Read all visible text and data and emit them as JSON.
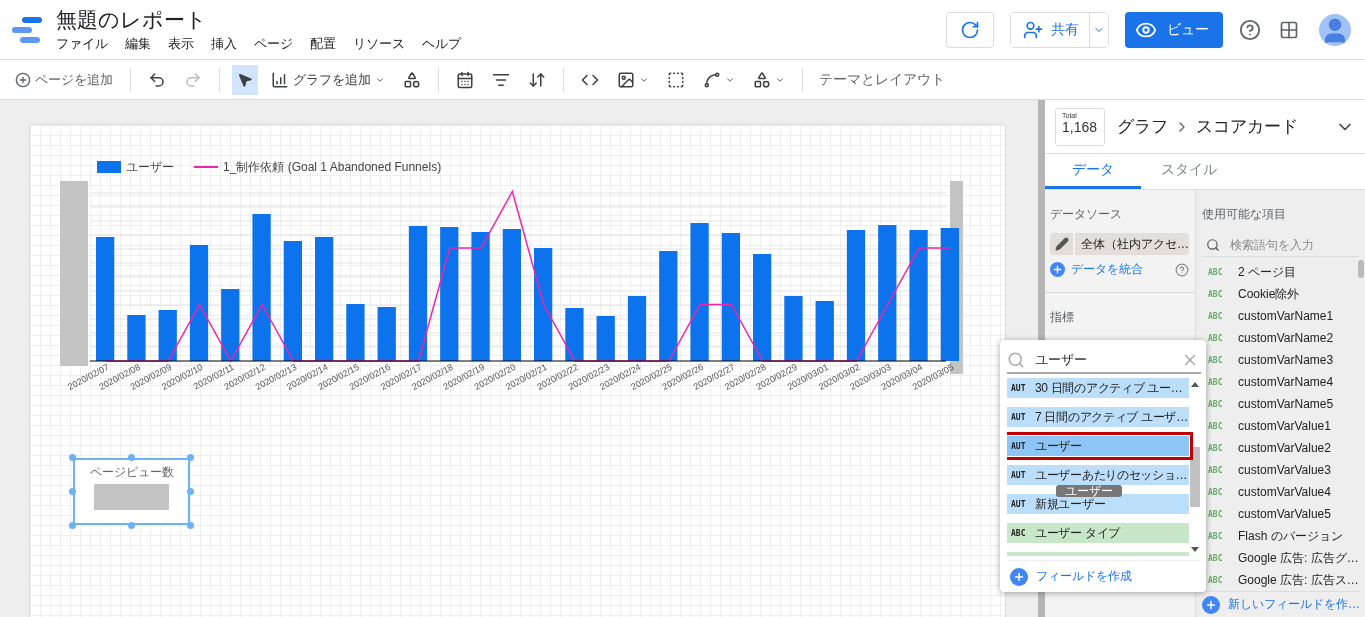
{
  "report": {
    "title": "無題のレポート",
    "menu": [
      "ファイル",
      "編集",
      "表示",
      "挿入",
      "ページ",
      "配置",
      "リソース",
      "ヘルプ"
    ]
  },
  "header_buttons": {
    "share": "共有",
    "view": "ビュー"
  },
  "toolbar": {
    "add_page": "ページを追加",
    "add_chart": "グラフを追加",
    "theme": "テーマとレイアウト"
  },
  "chart": {
    "legend": [
      {
        "label": "ユーザー",
        "kind": "bar"
      },
      {
        "label": "1_制作依頼 (Goal 1 Abandoned Funnels)",
        "kind": "line"
      }
    ],
    "dates": [
      "2020/02/07",
      "2020/02/08",
      "2020/02/09",
      "2020/02/10",
      "2020/02/11",
      "2020/02/12",
      "2020/02/13",
      "2020/02/14",
      "2020/02/15",
      "2020/02/16",
      "2020/02/17",
      "2020/02/18",
      "2020/02/19",
      "2020/02/20",
      "2020/02/21",
      "2020/02/22",
      "2020/02/23",
      "2020/02/24",
      "2020/02/25",
      "2020/02/26",
      "2020/02/27",
      "2020/02/28",
      "2020/02/29",
      "2020/03/01",
      "2020/03/02",
      "2020/03/03",
      "2020/03/04",
      "2020/03/05"
    ]
  },
  "scorecard": {
    "label": "ページビュー数",
    "selected": true
  },
  "panel": {
    "total_label": "Total",
    "total_value": "1,168",
    "breadcrumb": [
      "グラフ",
      "スコアカード"
    ],
    "tabs": [
      {
        "label": "データ",
        "selected": true
      },
      {
        "label": "スタイル",
        "selected": false
      }
    ],
    "data_source_heading": "データソース",
    "data_source": "全体（社内アクセ…",
    "blend": "データを統合",
    "metric_heading": "指標",
    "fields_heading": "使用可能な項目",
    "fields_search_placeholder": "検索語句を入力",
    "fields": [
      {
        "type": "ABC",
        "name": "2 ページ目"
      },
      {
        "type": "ABC",
        "name": "Cookie除外"
      },
      {
        "type": "ABC",
        "name": "customVarName1"
      },
      {
        "type": "ABC",
        "name": "customVarName2"
      },
      {
        "type": "ABC",
        "name": "customVarName3"
      },
      {
        "type": "ABC",
        "name": "customVarName4"
      },
      {
        "type": "ABC",
        "name": "customVarName5"
      },
      {
        "type": "ABC",
        "name": "customVarValue1"
      },
      {
        "type": "ABC",
        "name": "customVarValue2"
      },
      {
        "type": "ABC",
        "name": "customVarValue3"
      },
      {
        "type": "ABC",
        "name": "customVarValue4"
      },
      {
        "type": "ABC",
        "name": "customVarValue5"
      },
      {
        "type": "ABC",
        "name": "Flash のバージョン"
      },
      {
        "type": "ABC",
        "name": "Google 広告: 広告グ…"
      },
      {
        "type": "ABC",
        "name": "Google 広告: 広告ス…"
      }
    ],
    "new_field": "新しいフィールドを作…"
  },
  "field_picker": {
    "query": "ユーザー",
    "items": [
      {
        "type": "AUT",
        "name": "30 日間のアクティブ ユー…",
        "kind": "metric",
        "selected": false
      },
      {
        "type": "AUT",
        "name": "7 日間のアクティブ ユーザ…",
        "kind": "metric",
        "selected": false
      },
      {
        "type": "AUT",
        "name": "ユーザー",
        "kind": "metric",
        "selected": true
      },
      {
        "type": "AUT",
        "name": "ユーザーあたりのセッショ…",
        "kind": "metric",
        "selected": false
      },
      {
        "type": "AUT",
        "name": "新規ユーザー",
        "kind": "metric",
        "selected": false
      },
      {
        "type": "ABC",
        "name": "ユーザー タイプ",
        "kind": "dimension",
        "selected": false
      }
    ],
    "tooltip": "ユーザー",
    "create_field": "フィールドを作成"
  }
}
